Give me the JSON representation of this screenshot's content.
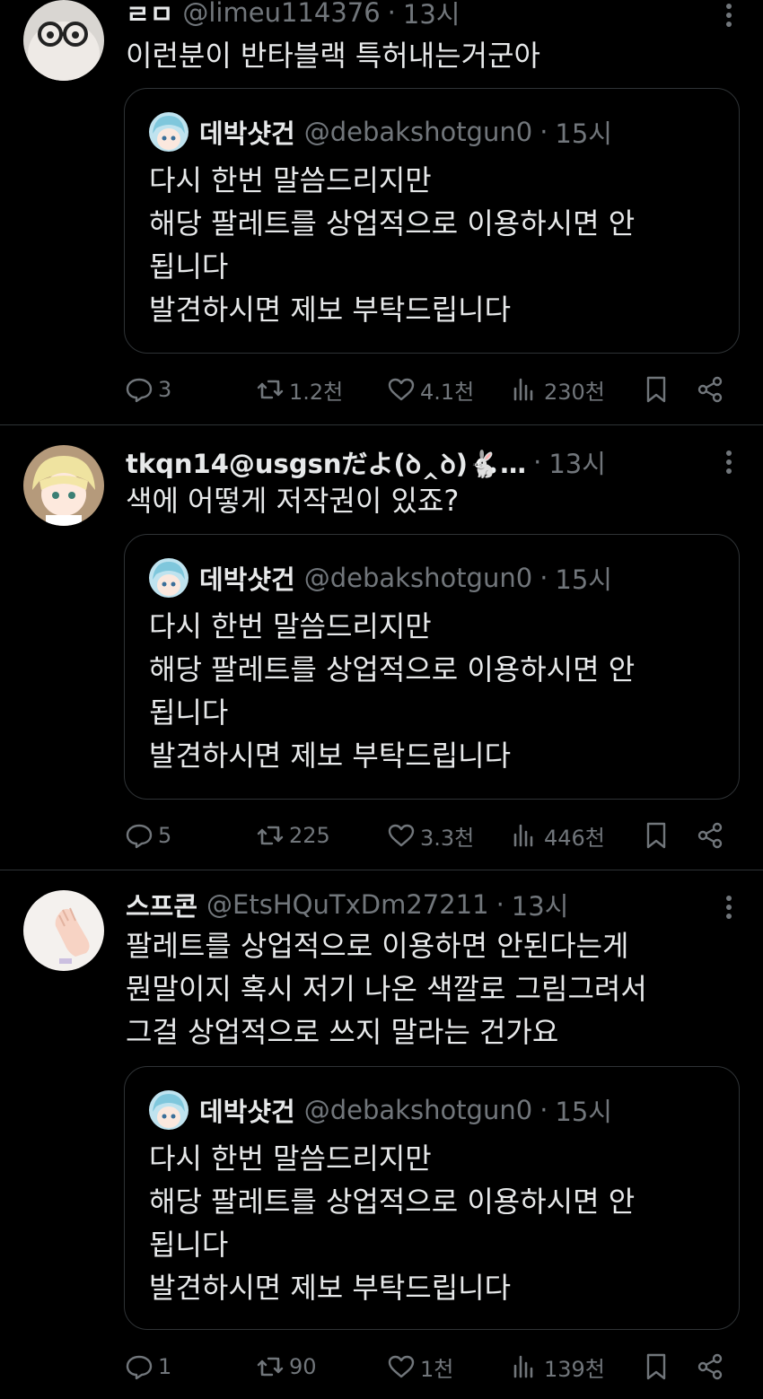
{
  "posts": [
    {
      "name": "ㄹㅁ",
      "handle": "@limeu114376",
      "sep": "·",
      "time": "13시",
      "text": "이런분이 반타블랙 특허내는거군아",
      "quote": {
        "name": "데박샷건",
        "handle": "@debakshotgun0",
        "sep": "·",
        "time": "15시",
        "text": "다시 한번 말씀드리지만\n해당 팔레트를 상업적으로 이용하시면 안\n됩니다\n발견하시면 제보 부탁드립니다"
      },
      "replies": "3",
      "reposts": "1.2천",
      "likes": "4.1천",
      "views": "230천"
    },
    {
      "name": "tkqn14@usgsnだよ(ꝺ‸ꝺ)🐇…",
      "handle": "",
      "sep": "·",
      "time": "13시",
      "text": "색에 어떻게 저작권이 있죠?",
      "quote": {
        "name": "데박샷건",
        "handle": "@debakshotgun0",
        "sep": "·",
        "time": "15시",
        "text": "다시 한번 말씀드리지만\n해당 팔레트를 상업적으로 이용하시면 안\n됩니다\n발견하시면 제보 부탁드립니다"
      },
      "replies": "5",
      "reposts": "225",
      "likes": "3.3천",
      "views": "446천"
    },
    {
      "name": "스프콘",
      "handle": "@EtsHQuTxDm27211",
      "sep": "·",
      "time": "13시",
      "text": "팔레트를 상업적으로 이용하면 안된다는게\n뭔말이지 혹시 저기 나온 색깔로 그림그려서\n그걸 상업적으로 쓰지 말라는 건가요",
      "quote": {
        "name": "데박샷건",
        "handle": "@debakshotgun0",
        "sep": "·",
        "time": "15시",
        "text": "다시 한번 말씀드리지만\n해당 팔레트를 상업적으로 이용하시면 안\n됩니다\n발견하시면 제보 부탁드립니다"
      },
      "replies": "1",
      "reposts": "90",
      "likes": "1천",
      "views": "139천"
    }
  ],
  "colors": {
    "background": "#000000",
    "text": "#e7e9ea",
    "muted": "#71767b",
    "border": "#2f3336"
  },
  "icons": [
    "reply-icon",
    "repost-icon",
    "like-icon",
    "views-icon",
    "bookmark-icon",
    "share-icon",
    "more-icon"
  ]
}
